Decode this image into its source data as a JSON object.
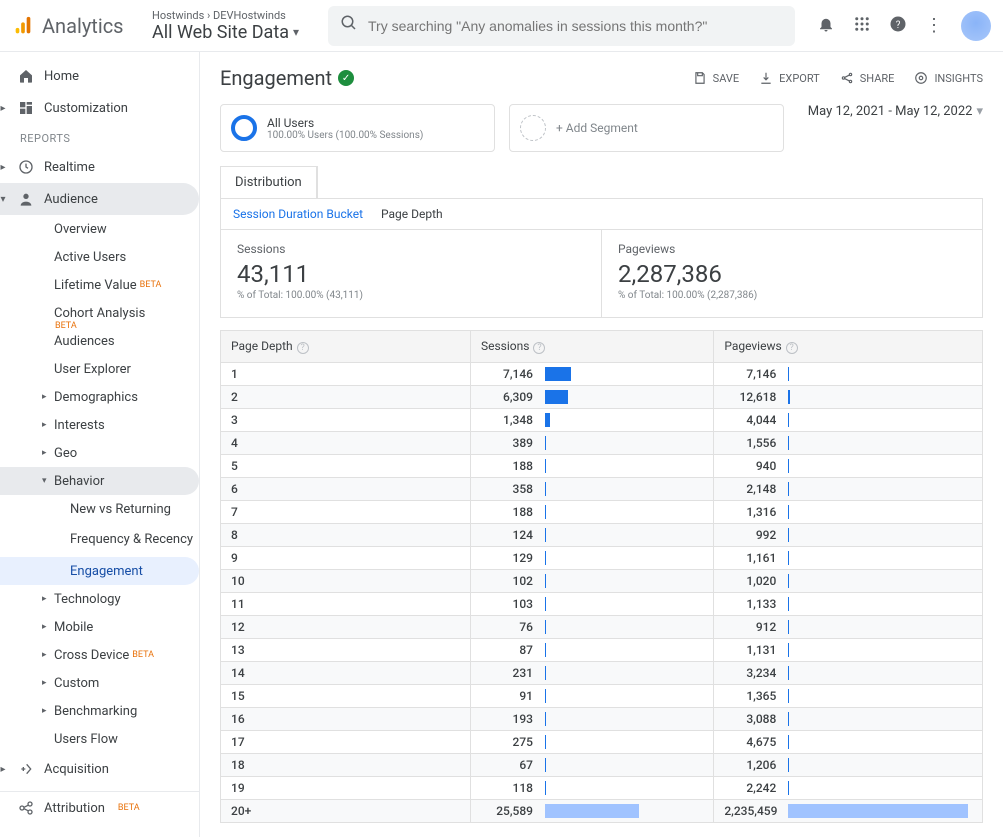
{
  "brand": "Analytics",
  "breadcrumb": "Hostwinds › DEVHostwinds",
  "view_name": "All Web Site Data",
  "search_placeholder": "Try searching \"Any anomalies in sessions this month?\"",
  "page_title": "Engagement",
  "actions": {
    "save": "SAVE",
    "export": "EXPORT",
    "share": "SHARE",
    "insights": "INSIGHTS"
  },
  "segments": {
    "all_users_title": "All Users",
    "all_users_sub": "100.00% Users (100.00% Sessions)",
    "add_segment": "+ Add Segment"
  },
  "date_range": "May 12, 2021 - May 12, 2022",
  "tab_main": "Distribution",
  "subtabs": {
    "a": "Session Duration Bucket",
    "b": "Page Depth"
  },
  "metrics": {
    "sessions_label": "Sessions",
    "sessions_value": "43,111",
    "sessions_sub": "% of Total: 100.00% (43,111)",
    "pageviews_label": "Pageviews",
    "pageviews_value": "2,287,386",
    "pageviews_sub": "% of Total: 100.00% (2,287,386)"
  },
  "table": {
    "headers": {
      "depth": "Page Depth",
      "sessions": "Sessions",
      "pageviews": "Pageviews"
    },
    "rows": [
      {
        "depth": "1",
        "sessions": "7,146",
        "s_pct": 16.6,
        "pageviews": "7,146",
        "p_pct": 0.4
      },
      {
        "depth": "2",
        "sessions": "6,309",
        "s_pct": 14.6,
        "pageviews": "12,618",
        "p_pct": 0.7
      },
      {
        "depth": "3",
        "sessions": "1,348",
        "s_pct": 3.1,
        "pageviews": "4,044",
        "p_pct": 0.3
      },
      {
        "depth": "4",
        "sessions": "389",
        "s_pct": 0.9,
        "pageviews": "1,556",
        "p_pct": 0.2
      },
      {
        "depth": "5",
        "sessions": "188",
        "s_pct": 0.5,
        "pageviews": "940",
        "p_pct": 0.2
      },
      {
        "depth": "6",
        "sessions": "358",
        "s_pct": 0.9,
        "pageviews": "2,148",
        "p_pct": 0.2
      },
      {
        "depth": "7",
        "sessions": "188",
        "s_pct": 0.5,
        "pageviews": "1,316",
        "p_pct": 0.2
      },
      {
        "depth": "8",
        "sessions": "124",
        "s_pct": 0.4,
        "pageviews": "992",
        "p_pct": 0.2
      },
      {
        "depth": "9",
        "sessions": "129",
        "s_pct": 0.4,
        "pageviews": "1,161",
        "p_pct": 0.2
      },
      {
        "depth": "10",
        "sessions": "102",
        "s_pct": 0.4,
        "pageviews": "1,020",
        "p_pct": 0.2
      },
      {
        "depth": "11",
        "sessions": "103",
        "s_pct": 0.4,
        "pageviews": "1,133",
        "p_pct": 0.2
      },
      {
        "depth": "12",
        "sessions": "76",
        "s_pct": 0.3,
        "pageviews": "912",
        "p_pct": 0.2
      },
      {
        "depth": "13",
        "sessions": "87",
        "s_pct": 0.3,
        "pageviews": "1,131",
        "p_pct": 0.2
      },
      {
        "depth": "14",
        "sessions": "231",
        "s_pct": 0.6,
        "pageviews": "3,234",
        "p_pct": 0.3
      },
      {
        "depth": "15",
        "sessions": "91",
        "s_pct": 0.3,
        "pageviews": "1,365",
        "p_pct": 0.2
      },
      {
        "depth": "16",
        "sessions": "193",
        "s_pct": 0.5,
        "pageviews": "3,088",
        "p_pct": 0.3
      },
      {
        "depth": "17",
        "sessions": "275",
        "s_pct": 0.7,
        "pageviews": "4,675",
        "p_pct": 0.3
      },
      {
        "depth": "18",
        "sessions": "67",
        "s_pct": 0.3,
        "pageviews": "1,206",
        "p_pct": 0.2
      },
      {
        "depth": "19",
        "sessions": "118",
        "s_pct": 0.4,
        "pageviews": "2,242",
        "p_pct": 0.2
      },
      {
        "depth": "20+",
        "sessions": "25,589",
        "s_pct": 59.4,
        "pageviews": "2,235,459",
        "p_pct": 97.7,
        "light": true
      }
    ]
  },
  "sidebar": {
    "home": "Home",
    "customization": "Customization",
    "reports_heading": "REPORTS",
    "realtime": "Realtime",
    "audience": "Audience",
    "audience_children": {
      "overview": "Overview",
      "active_users": "Active Users",
      "lifetime_value": "Lifetime Value",
      "cohort": "Cohort Analysis",
      "audiences": "Audiences",
      "user_explorer": "User Explorer",
      "demographics": "Demographics",
      "interests": "Interests",
      "geo": "Geo",
      "behavior": "Behavior",
      "new_vs_returning": "New vs Returning",
      "frequency": "Frequency & Recency",
      "engagement": "Engagement",
      "technology": "Technology",
      "mobile": "Mobile",
      "cross_device": "Cross Device",
      "custom": "Custom",
      "benchmarking": "Benchmarking",
      "users_flow": "Users Flow"
    },
    "acquisition": "Acquisition",
    "attribution": "Attribution",
    "beta_tag": "BETA"
  }
}
